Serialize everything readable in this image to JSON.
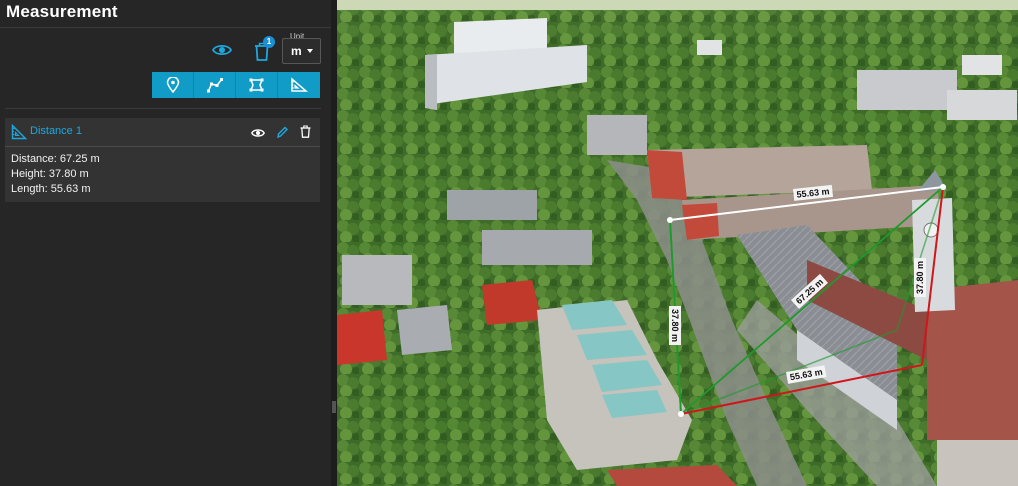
{
  "panel": {
    "title": "Measurement",
    "trash_badge": "1",
    "unit": {
      "label": "Unit",
      "value": "m"
    }
  },
  "toolbar_tools": [
    {
      "name": "point-tool",
      "icon": "map-pin-icon"
    },
    {
      "name": "polyline-tool",
      "icon": "polyline-icon"
    },
    {
      "name": "area-tool",
      "icon": "polygon-area-icon"
    },
    {
      "name": "distance-tool",
      "icon": "set-square-icon"
    }
  ],
  "measurement": {
    "name": "Distance 1",
    "stats": [
      "Distance: 67.25 m",
      "Height: 37.80 m",
      "Length: 55.63 m"
    ]
  },
  "map_labels": {
    "top_length": "55.63 m",
    "bottom_length": "55.63 m",
    "diagonal": "67.25 m",
    "left_height": "37.80 m",
    "right_height": "37.80 m"
  },
  "colors": {
    "accent": "#119cc8",
    "title_link": "#1ea7dd",
    "panel_bg": "#262626",
    "card_bg": "#333333",
    "measure_white": "#ffffff",
    "measure_green": "#1e9a2c",
    "measure_red": "#d0161a"
  }
}
